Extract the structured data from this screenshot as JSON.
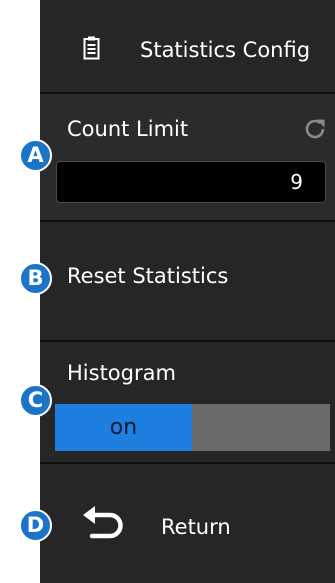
{
  "header": {
    "title": "Statistics Config",
    "icon": "document-icon"
  },
  "count_limit": {
    "label": "Count Limit",
    "value": "9",
    "icon": "reset-icon"
  },
  "reset_statistics": {
    "label": "Reset Statistics"
  },
  "histogram": {
    "label": "Histogram",
    "state": "on"
  },
  "return": {
    "label": "Return",
    "icon": "return-arrow-icon"
  },
  "callouts": [
    "A",
    "B",
    "C",
    "D"
  ],
  "colors": {
    "panel": "#262626",
    "toggle_on": "#1f7fe0",
    "toggle_off": "#6a6a6a",
    "badge": "#1b74c8"
  }
}
